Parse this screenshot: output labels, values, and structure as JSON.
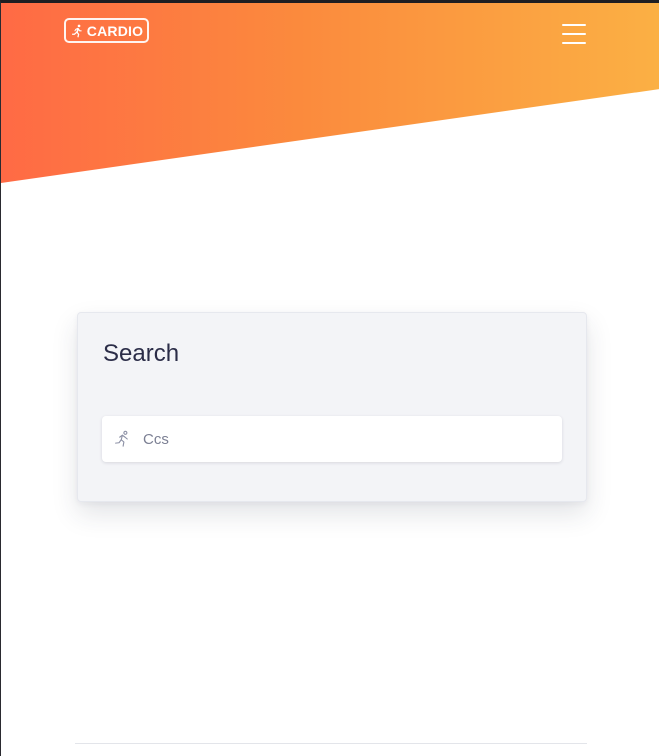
{
  "header": {
    "logo_text": "CARDIO",
    "logo_icon": "running-person-icon",
    "menu_icon": "hamburger-menu-icon",
    "gradient_colors": [
      "#ff6a45",
      "#fbb044"
    ]
  },
  "search_card": {
    "title": "Search",
    "input_value": "Ccs",
    "input_icon": "running-person-icon"
  }
}
